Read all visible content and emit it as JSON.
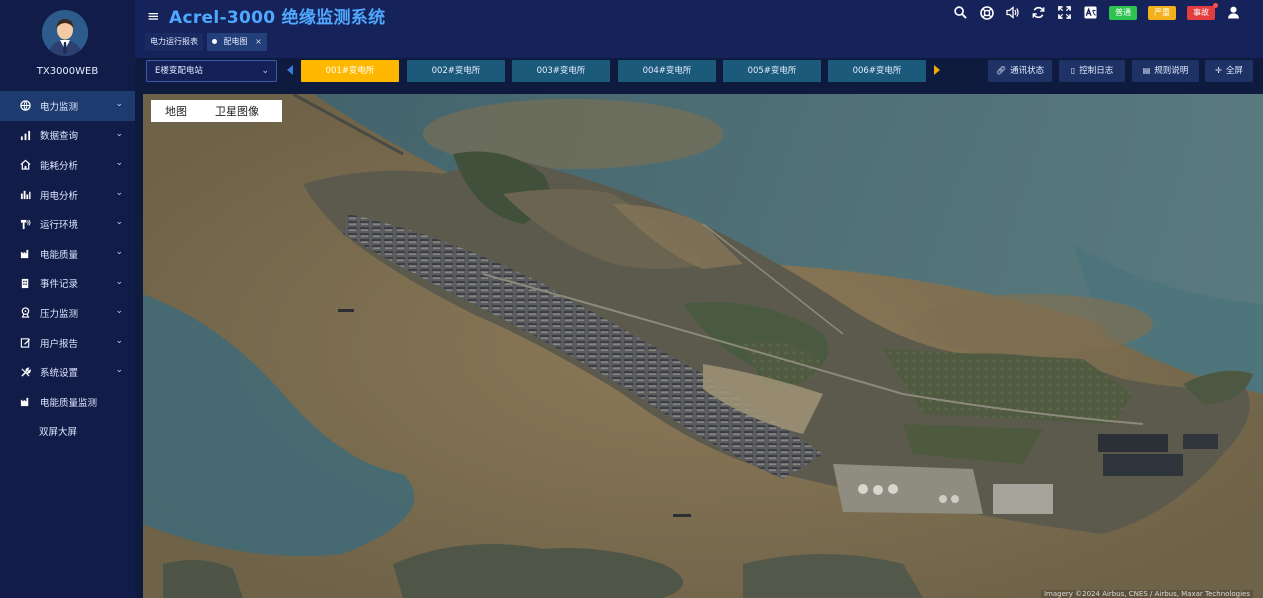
{
  "app": {
    "title": "Acrel-3000 绝缘监测系统"
  },
  "user": {
    "name": "TX3000WEB"
  },
  "sidebar": {
    "items": [
      {
        "label": "电力监测",
        "icon": "globe-icon",
        "active": true,
        "chevron": true
      },
      {
        "label": "数据查询",
        "icon": "bar-chart-icon",
        "chevron": true
      },
      {
        "label": "能耗分析",
        "icon": "home-icon",
        "chevron": true
      },
      {
        "label": "用电分析",
        "icon": "column-chart-icon",
        "chevron": true
      },
      {
        "label": "运行环境",
        "icon": "antenna-icon",
        "chevron": true
      },
      {
        "label": "电能质量",
        "icon": "factory-icon",
        "chevron": true
      },
      {
        "label": "事件记录",
        "icon": "building-icon",
        "chevron": true
      },
      {
        "label": "压力监测",
        "icon": "pressure-icon",
        "chevron": true
      },
      {
        "label": "用户报告",
        "icon": "report-icon",
        "chevron": true
      },
      {
        "label": "系统设置",
        "icon": "wrench-icon",
        "chevron": true
      },
      {
        "label": "电能质量监测",
        "icon": "factory-icon",
        "chevron": false
      },
      {
        "label": "双屏大屏",
        "icon": "",
        "chevron": false
      }
    ]
  },
  "header": {
    "badges": {
      "normal": "普通",
      "severe": "严重",
      "fault": "事故"
    }
  },
  "tabs": [
    {
      "label": "电力运行报表",
      "active": false
    },
    {
      "label": "配电图",
      "active": true
    }
  ],
  "toolbar": {
    "station_select": "E楼变配电站",
    "substations": [
      "001#变电所",
      "002#变电所",
      "003#变电所",
      "004#变电所",
      "005#变电所",
      "006#变电所"
    ],
    "active_substation": 0,
    "buttons": {
      "comm_status": "通讯状态",
      "control_log": "控制日志",
      "rules": "规则说明",
      "fullscreen": "全屏"
    }
  },
  "map": {
    "switch": {
      "map": "地图",
      "satellite": "卫星图像"
    },
    "attribution": "Imagery ©2024 Airbus, CNES / Airbus, Maxar Technologies"
  },
  "colors": {
    "accent": "#4fa8ff",
    "active_tab": "#ffb800",
    "sub_tab": "#1b5a7a",
    "sidebar_bg": "#121c48",
    "header_bg": "#16235a"
  }
}
